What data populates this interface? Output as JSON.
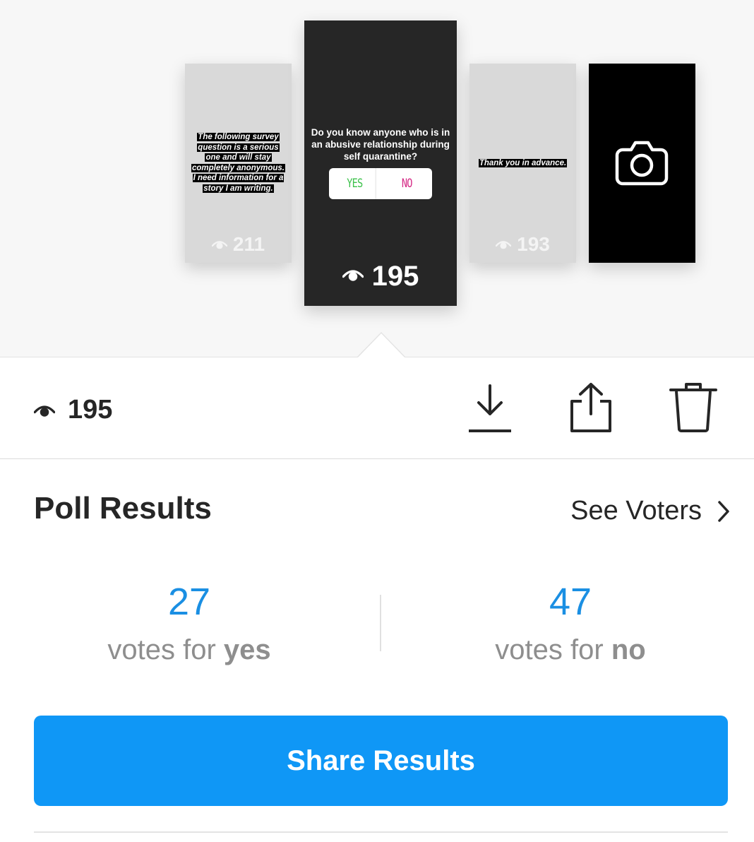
{
  "stories": [
    {
      "text_lines": [
        "The following survey",
        "question is a serious",
        "one and will stay",
        "completely anonymous.",
        "I need information for a",
        "story I am writing."
      ],
      "views": "211"
    },
    {
      "question": "Do you know anyone who is in an abusive relationship during self quarantine?",
      "poll_yes": "YES",
      "poll_no": "NO",
      "views": "195"
    },
    {
      "text": "Thank you in advance.",
      "views": "193"
    },
    {
      "icon": "camera-icon"
    }
  ],
  "stats": {
    "views": "195",
    "icons": [
      "eye-icon",
      "download-icon",
      "share-icon",
      "trash-icon"
    ]
  },
  "poll": {
    "title": "Poll Results",
    "see_voters": "See Voters",
    "yes_count": "27",
    "yes_prefix": "votes for ",
    "yes_word": "yes",
    "no_count": "47",
    "no_prefix": "votes for ",
    "no_word": "no"
  },
  "share_button": "Share Results",
  "colors": {
    "accent": "#0f97f6",
    "count_blue": "#1a8fe3",
    "poll_yes": "#3bc14a",
    "poll_no": "#d52b86"
  }
}
